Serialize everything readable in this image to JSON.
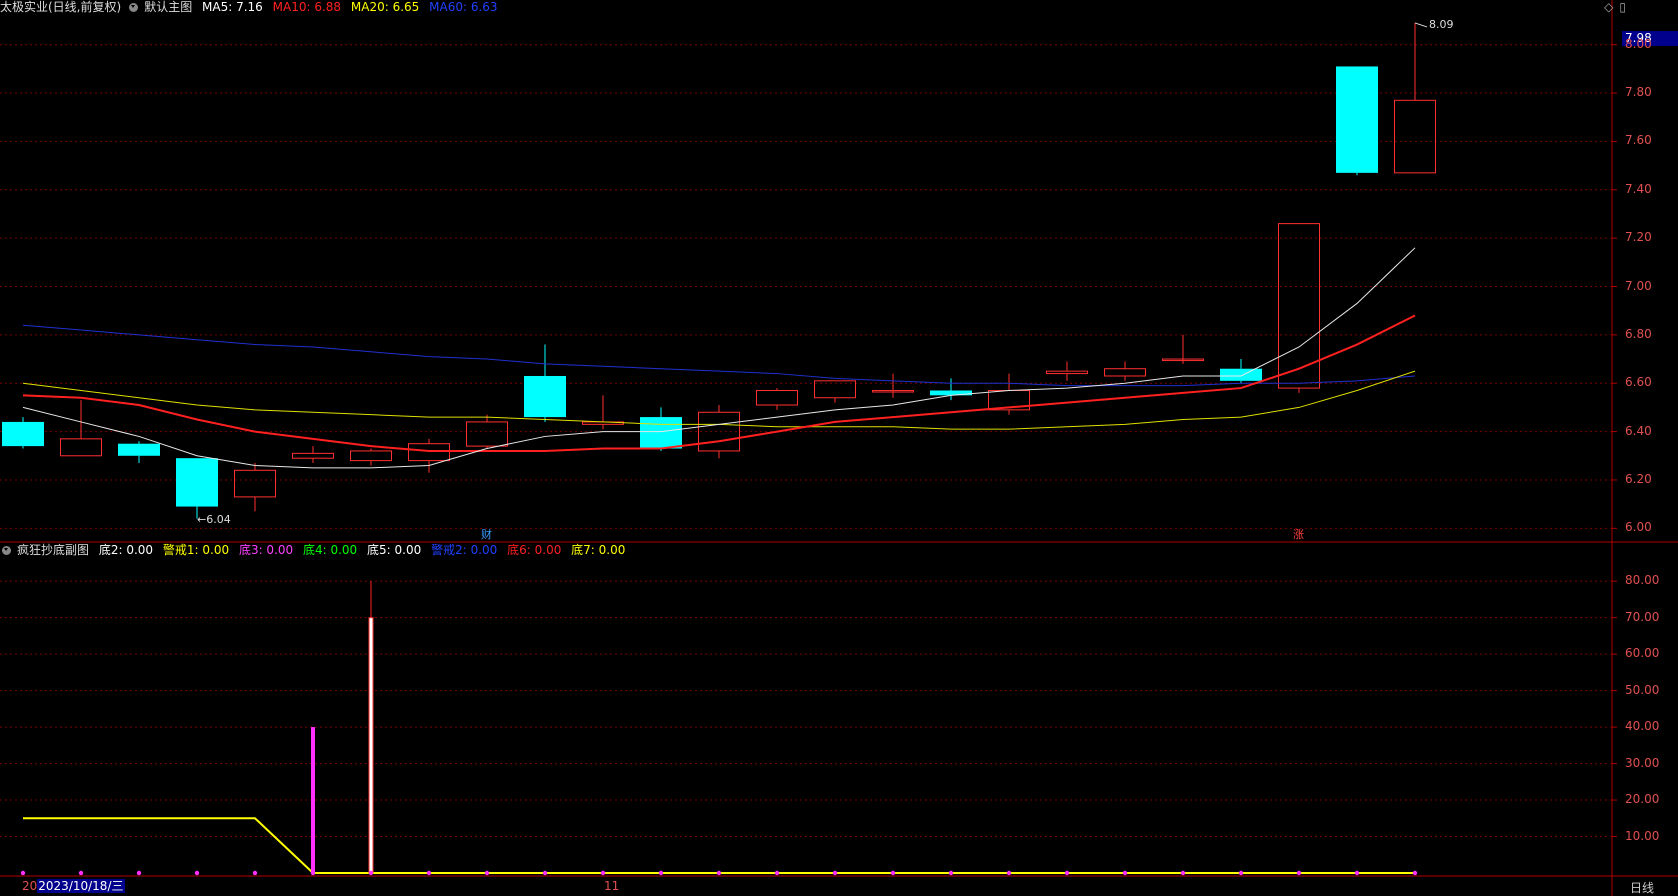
{
  "main_header": {
    "stock": "太极实业(日线,前复权)",
    "view": "默认主图",
    "ma": [
      {
        "label": "MA5: 7.16",
        "color": "#ffffff"
      },
      {
        "label": "MA10: 6.88",
        "color": "#ff2020"
      },
      {
        "label": "MA20: 6.65",
        "color": "#ffff00"
      },
      {
        "label": "MA60: 6.63",
        "color": "#2040ff"
      }
    ]
  },
  "window_controls": {
    "restore_icon": "◇",
    "maximize_icon": "▯"
  },
  "sub_header": {
    "name": "疯狂抄底副图",
    "fields": [
      {
        "label": "底2: 0.00",
        "color": "#ffffff"
      },
      {
        "label": "警戒1: 0.00",
        "color": "#ffff00"
      },
      {
        "label": "底3: 0.00",
        "color": "#ff40ff"
      },
      {
        "label": "底4: 0.00",
        "color": "#00ff00"
      },
      {
        "label": "底5: 0.00",
        "color": "#ffffff"
      },
      {
        "label": "警戒2: 0.00",
        "color": "#2040ff"
      },
      {
        "label": "底6: 0.00",
        "color": "#ff2020"
      },
      {
        "label": "底7: 0.00",
        "color": "#ffff00"
      }
    ]
  },
  "current_price": "7.98",
  "high_marker": "8.09",
  "low_marker": "6.04",
  "event_tags": [
    {
      "text": "财",
      "color": "#3a9bff"
    },
    {
      "text": "涨",
      "color": "#ff4040"
    }
  ],
  "footer": {
    "year_prefix": "20",
    "date": "2023/10/18/三",
    "month_mark": "11",
    "period": "日线"
  },
  "colors": {
    "up": "#ff3030",
    "down": "#00ffff",
    "grid": "#7a0000",
    "axis": "#b00000"
  },
  "chart_data": [
    {
      "type": "candlestick",
      "ylim": [
        5.96,
        8.16
      ],
      "yticks": [
        "8.00",
        "7.80",
        "7.60",
        "7.40",
        "7.20",
        "7.00",
        "6.80",
        "6.60",
        "6.40",
        "6.20",
        "6.00"
      ],
      "candles": [
        {
          "o": 6.44,
          "h": 6.46,
          "l": 6.33,
          "c": 6.34
        },
        {
          "o": 6.3,
          "h": 6.53,
          "l": 6.3,
          "c": 6.37
        },
        {
          "o": 6.35,
          "h": 6.36,
          "l": 6.27,
          "c": 6.3
        },
        {
          "o": 6.29,
          "h": 6.29,
          "l": 6.04,
          "c": 6.09
        },
        {
          "o": 6.13,
          "h": 6.27,
          "l": 6.07,
          "c": 6.24
        },
        {
          "o": 6.29,
          "h": 6.34,
          "l": 6.27,
          "c": 6.31
        },
        {
          "o": 6.28,
          "h": 6.33,
          "l": 6.26,
          "c": 6.32
        },
        {
          "o": 6.28,
          "h": 6.37,
          "l": 6.23,
          "c": 6.35
        },
        {
          "o": 6.34,
          "h": 6.47,
          "l": 6.33,
          "c": 6.44
        },
        {
          "o": 6.63,
          "h": 6.76,
          "l": 6.44,
          "c": 6.46
        },
        {
          "o": 6.43,
          "h": 6.55,
          "l": 6.41,
          "c": 6.44
        },
        {
          "o": 6.46,
          "h": 6.5,
          "l": 6.32,
          "c": 6.33
        },
        {
          "o": 6.32,
          "h": 6.51,
          "l": 6.29,
          "c": 6.48
        },
        {
          "o": 6.51,
          "h": 6.58,
          "l": 6.49,
          "c": 6.57
        },
        {
          "o": 6.54,
          "h": 6.61,
          "l": 6.52,
          "c": 6.61
        },
        {
          "o": 6.57,
          "h": 6.64,
          "l": 6.54,
          "c": 6.57
        },
        {
          "o": 6.57,
          "h": 6.62,
          "l": 6.53,
          "c": 6.55
        },
        {
          "o": 6.49,
          "h": 6.64,
          "l": 6.47,
          "c": 6.57
        },
        {
          "o": 6.64,
          "h": 6.69,
          "l": 6.61,
          "c": 6.65
        },
        {
          "o": 6.63,
          "h": 6.69,
          "l": 6.61,
          "c": 6.66
        },
        {
          "o": 6.7,
          "h": 6.8,
          "l": 6.68,
          "c": 6.7
        },
        {
          "o": 6.66,
          "h": 6.7,
          "l": 6.6,
          "c": 6.61
        },
        {
          "o": 6.58,
          "h": 7.26,
          "l": 6.56,
          "c": 7.26
        },
        {
          "o": 7.91,
          "h": 7.91,
          "l": 7.46,
          "c": 7.47
        },
        {
          "o": 7.47,
          "h": 8.09,
          "l": 7.47,
          "c": 7.77
        }
      ],
      "ma5": [
        6.5,
        6.44,
        6.38,
        6.3,
        6.26,
        6.25,
        6.25,
        6.26,
        6.33,
        6.38,
        6.4,
        6.4,
        6.43,
        6.46,
        6.49,
        6.51,
        6.55,
        6.57,
        6.58,
        6.6,
        6.63,
        6.63,
        6.75,
        6.93,
        7.16
      ],
      "ma10": [
        6.55,
        6.54,
        6.51,
        6.45,
        6.4,
        6.37,
        6.34,
        6.32,
        6.32,
        6.32,
        6.33,
        6.33,
        6.36,
        6.4,
        6.44,
        6.46,
        6.48,
        6.5,
        6.52,
        6.54,
        6.56,
        6.58,
        6.66,
        6.76,
        6.88
      ],
      "ma20": [
        6.6,
        6.57,
        6.54,
        6.51,
        6.49,
        6.48,
        6.47,
        6.46,
        6.46,
        6.45,
        6.44,
        6.43,
        6.43,
        6.42,
        6.42,
        6.42,
        6.41,
        6.41,
        6.42,
        6.43,
        6.45,
        6.46,
        6.5,
        6.57,
        6.65
      ],
      "ma60": [
        6.84,
        6.82,
        6.8,
        6.78,
        6.76,
        6.75,
        6.73,
        6.71,
        6.7,
        6.68,
        6.67,
        6.66,
        6.65,
        6.64,
        6.62,
        6.61,
        6.6,
        6.6,
        6.59,
        6.59,
        6.59,
        6.6,
        6.6,
        6.61,
        6.63
      ]
    },
    {
      "type": "bar",
      "ylim": [
        0,
        88
      ],
      "yticks": [
        "80.00",
        "70.00",
        "60.00",
        "50.00",
        "40.00",
        "30.00",
        "20.00",
        "10.00"
      ],
      "series": [
        {
          "name": "警戒1",
          "type": "line",
          "values": [
            15,
            15,
            15,
            15,
            15,
            0,
            0,
            0,
            0,
            0,
            0,
            0,
            0,
            0,
            0,
            0,
            0,
            0,
            0,
            0,
            0,
            0,
            0,
            0,
            0
          ]
        },
        {
          "name": "底3",
          "type": "bar",
          "values": [
            0,
            0,
            0,
            0,
            0,
            40,
            0,
            0,
            0,
            0,
            0,
            0,
            0,
            0,
            0,
            0,
            0,
            0,
            0,
            0,
            0,
            0,
            0,
            0,
            0
          ]
        },
        {
          "name": "底6",
          "type": "bar",
          "values": [
            0,
            0,
            0,
            0,
            0,
            0,
            80,
            0,
            0,
            0,
            0,
            0,
            0,
            0,
            0,
            0,
            0,
            0,
            0,
            0,
            0,
            0,
            0,
            0,
            0
          ]
        },
        {
          "name": "底2",
          "type": "bar",
          "values": [
            0,
            0,
            0,
            0,
            0,
            0,
            70,
            0,
            0,
            0,
            0,
            0,
            0,
            0,
            0,
            0,
            0,
            0,
            0,
            0,
            0,
            0,
            0,
            0,
            0
          ]
        }
      ]
    }
  ]
}
